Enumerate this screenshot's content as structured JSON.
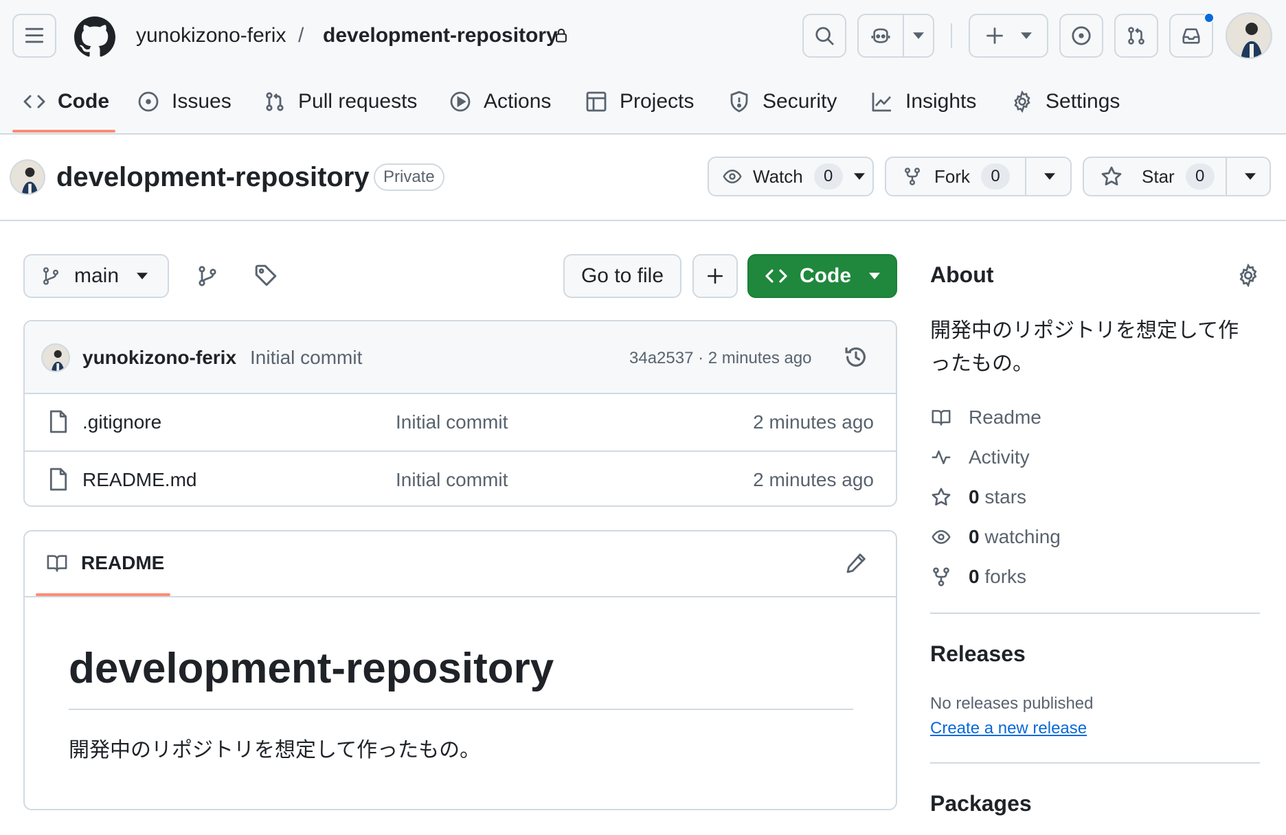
{
  "header": {
    "owner": "yunokizono-ferix",
    "separator": "/",
    "repo": "development-repository",
    "icons": [
      "menu-icon",
      "github-logo",
      "search-icon",
      "copilot-icon",
      "plus-icon",
      "issue-icon",
      "pull-request-icon",
      "inbox-icon"
    ]
  },
  "tabs": [
    {
      "label": "Code",
      "icon": "code-icon"
    },
    {
      "label": "Issues",
      "icon": "issue-icon"
    },
    {
      "label": "Pull requests",
      "icon": "pull-request-icon"
    },
    {
      "label": "Actions",
      "icon": "play-icon"
    },
    {
      "label": "Projects",
      "icon": "table-icon"
    },
    {
      "label": "Security",
      "icon": "shield-icon"
    },
    {
      "label": "Insights",
      "icon": "graph-icon"
    },
    {
      "label": "Settings",
      "icon": "gear-icon"
    }
  ],
  "repo": {
    "name": "development-repository",
    "visibility": "Private",
    "watch_label": "Watch",
    "watch_count": "0",
    "fork_label": "Fork",
    "fork_count": "0",
    "star_label": "Star",
    "star_count": "0"
  },
  "toolbar": {
    "branch": "main",
    "go_to_file": "Go to file",
    "add_label": "+",
    "code_label": "Code"
  },
  "commit": {
    "author": "yunokizono-ferix",
    "message": "Initial commit",
    "meta": "34a2537 · 2 minutes ago"
  },
  "files": [
    {
      "name": ".gitignore",
      "message": "Initial commit",
      "time": "2 minutes ago"
    },
    {
      "name": "README.md",
      "message": "Initial commit",
      "time": "2 minutes ago"
    }
  ],
  "readme": {
    "tab_label": "README",
    "heading": "development-repository",
    "body": "開発中のリポジトリを想定して作ったもの。"
  },
  "about": {
    "title": "About",
    "description_line1": "開発中のリポジトリを想定して作",
    "description_line2": "ったもの。",
    "readme_link": "Readme",
    "activity_link": "Activity",
    "stars_count": "0",
    "stars_label": "stars",
    "watching_count": "0",
    "watching_label": "watching",
    "forks_count": "0",
    "forks_label": "forks"
  },
  "releases": {
    "title": "Releases",
    "empty": "No releases published",
    "create_link": "Create a new release"
  },
  "packages": {
    "title": "Packages"
  },
  "colors": {
    "accent_underline": "#fd8c73",
    "primary_green": "#1f883d",
    "link_blue": "#0969da",
    "notification_dot": "#0969da"
  }
}
